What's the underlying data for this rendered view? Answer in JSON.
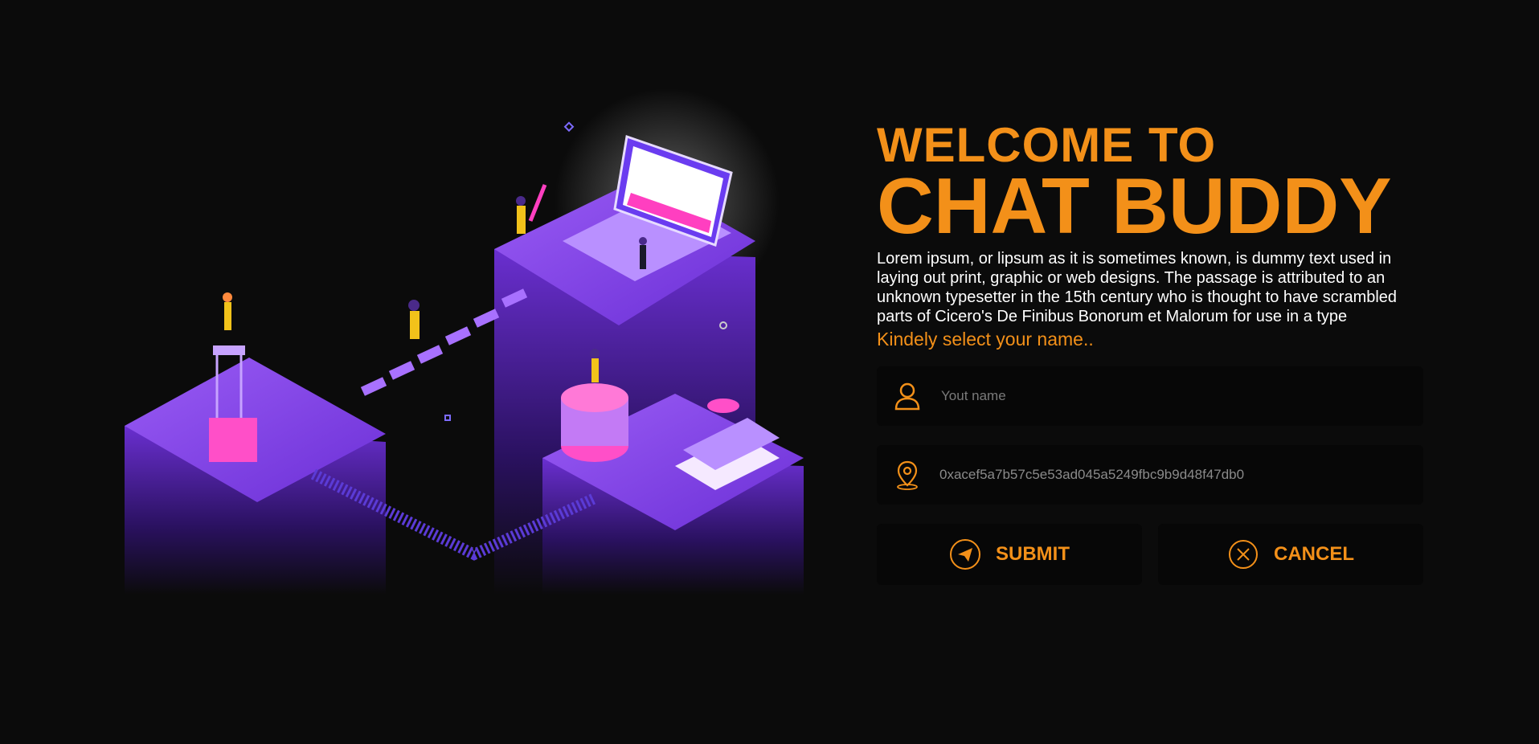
{
  "colors": {
    "background": "#0b0b0b",
    "accent": "#f39019",
    "text": "#ffffff",
    "field_bg": "#070707",
    "illustration_primary": "#7b3fe4"
  },
  "header": {
    "welcome": "WELCOME TO",
    "brand": "CHAT BUDDY"
  },
  "description": "Lorem ipsum, or lipsum as it is sometimes known, is dummy text used in laying out print, graphic or web designs. The passage is attributed to an unknown typesetter in the 15th century who is thought to have scrambled parts of Cicero's De Finibus Bonorum et Malorum for use in a type",
  "prompt": "Kindely select your name..",
  "name_field": {
    "placeholder": "Yout name",
    "value": "",
    "icon": "user-icon"
  },
  "address_field": {
    "value": "0xacef5a7b57c5e53ad045a5249fbc9b9d48f47db0",
    "icon": "location-pin-icon"
  },
  "buttons": {
    "submit": {
      "label": "SUBMIT",
      "icon": "send-icon"
    },
    "cancel": {
      "label": "CANCEL",
      "icon": "close-circle-icon"
    }
  }
}
